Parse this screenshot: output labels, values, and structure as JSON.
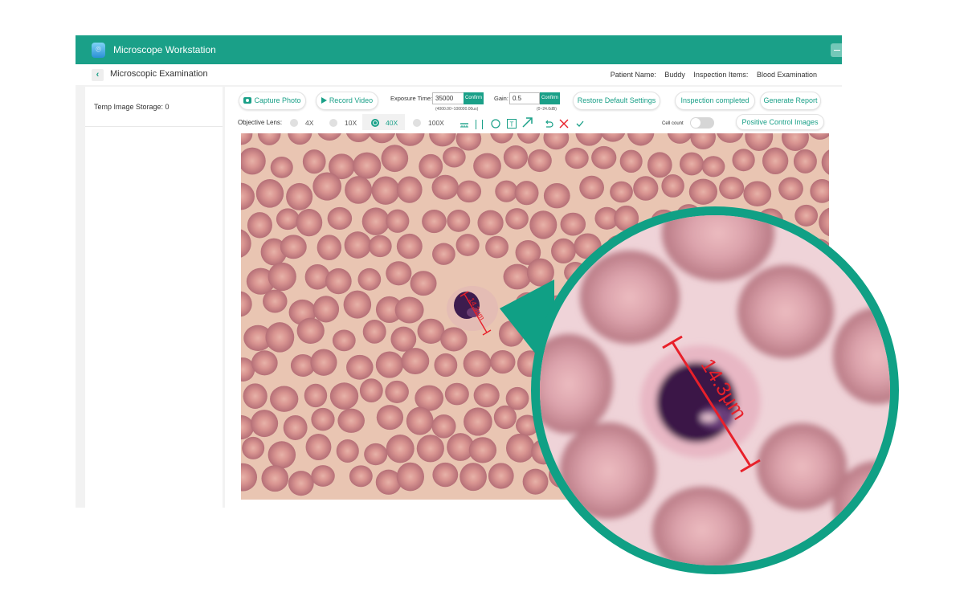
{
  "app": {
    "title": "Microscope Workstation",
    "accent_color": "#1aa088"
  },
  "header": {
    "title": "Microscopic Examination",
    "patient_label": "Patient Name:",
    "patient_value": "Buddy",
    "items_label": "Inspection Items:",
    "items_value": "Blood Examination"
  },
  "sidebar": {
    "storage_text": "Temp Image Storage: 0"
  },
  "toolbar": {
    "capture_label": "Capture Photo",
    "record_label": "Record Video",
    "exposure_label": "Exposure Time:",
    "exposure_value": "35000",
    "exposure_confirm": "Confirm",
    "exposure_hint": "(4000.00~100000.00us)",
    "gain_label": "Gain:",
    "gain_value": "0.5",
    "gain_confirm": "Confirm",
    "gain_hint": "(0~24.0dB)",
    "restore_label": "Restore Default Settings",
    "completed_label": "Inspection completed",
    "report_label": "Generate Report",
    "lens_label": "Objective Lens:",
    "lenses": [
      "4X",
      "10X",
      "40X",
      "100X"
    ],
    "selected_lens": "40X",
    "cell_count_label": "Cell count",
    "cell_count_on": false,
    "positive_label": "Positive Control Images"
  },
  "measurement": {
    "label": "14.3μm",
    "color": "#e8202a"
  }
}
